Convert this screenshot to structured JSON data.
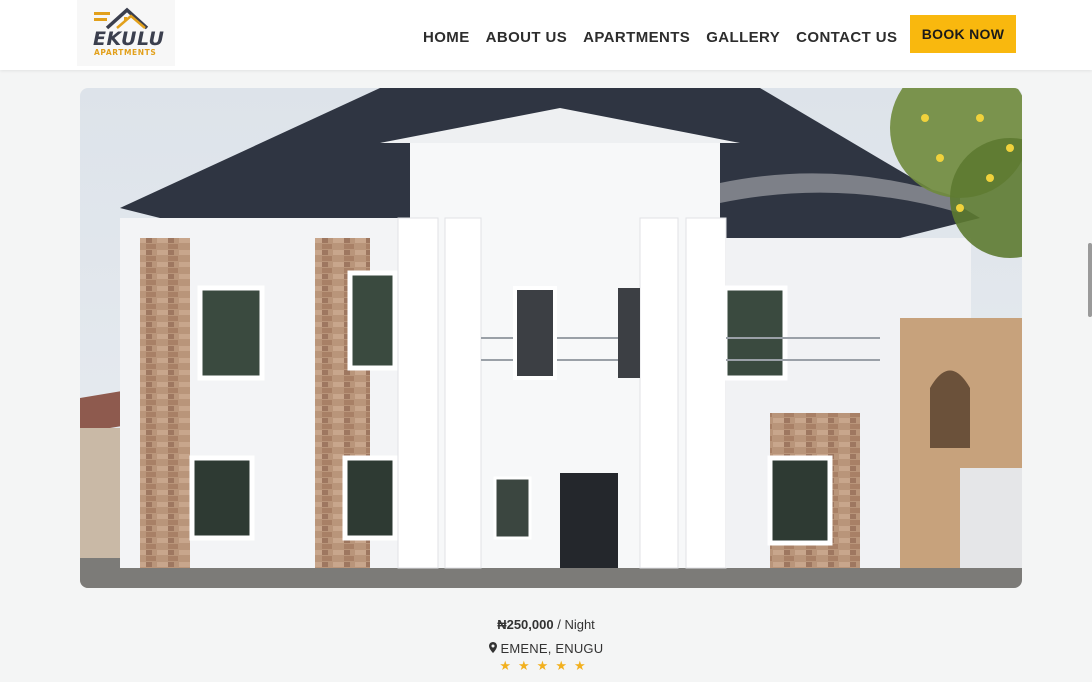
{
  "brand": {
    "name": "EKULU",
    "tagline": "APARTMENTS",
    "colors": {
      "primary": "#3b3f4e",
      "accent": "#e2a01b"
    }
  },
  "nav": {
    "items": [
      {
        "label": "HOME"
      },
      {
        "label": "ABOUT US"
      },
      {
        "label": "APARTMENTS"
      },
      {
        "label": "GALLERY"
      },
      {
        "label": "CONTACT US"
      }
    ],
    "cta_label": "BOOK NOW",
    "cta_color": "#f9b80e"
  },
  "listing": {
    "price": "₦250,000",
    "price_unit": "/ Night",
    "location": "EMENE, ENUGU",
    "location_icon": "map-marker-icon",
    "rating_stars": 5,
    "stars": "★★★★★",
    "star_color": "#f2b01e"
  }
}
